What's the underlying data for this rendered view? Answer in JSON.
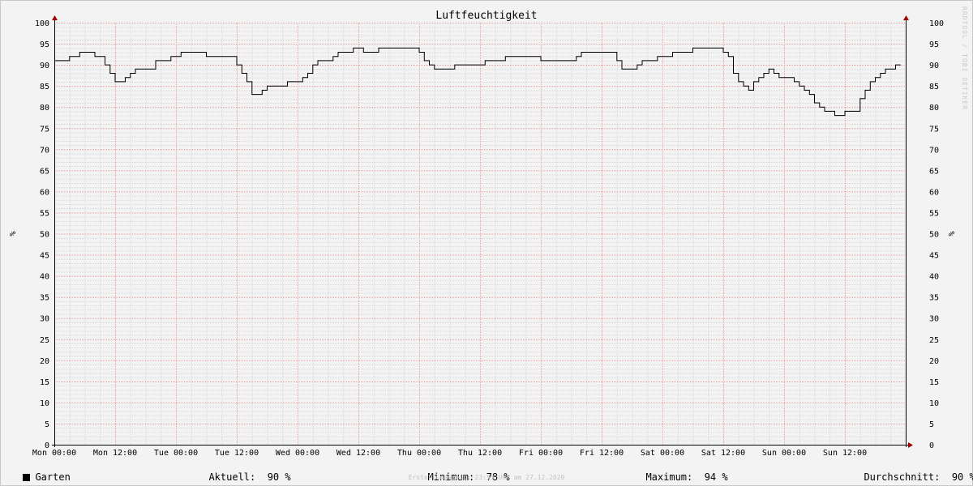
{
  "chart_data": {
    "type": "line",
    "title": "Luftfeuchtigkeit",
    "ylabel": "%",
    "ylim": [
      0,
      100
    ],
    "y_ticks": [
      0,
      5,
      10,
      15,
      20,
      25,
      30,
      35,
      40,
      45,
      50,
      55,
      60,
      65,
      70,
      75,
      80,
      85,
      90,
      95,
      100
    ],
    "x_ticks": [
      "Mon 00:00",
      "Mon 12:00",
      "Tue 00:00",
      "Tue 12:00",
      "Wed 00:00",
      "Wed 12:00",
      "Thu 00:00",
      "Thu 12:00",
      "Fri 00:00",
      "Fri 12:00",
      "Sat 00:00",
      "Sat 12:00",
      "Sun 00:00",
      "Sun 12:00"
    ],
    "x_unit": "hours since Mon 00:00",
    "xlim": [
      0,
      168
    ],
    "grid": true,
    "legend_position": "bottom-left",
    "series": [
      {
        "name": "Garten",
        "color": "#000000",
        "points": [
          [
            0,
            91
          ],
          [
            2,
            91
          ],
          [
            3,
            92
          ],
          [
            4,
            92
          ],
          [
            5,
            93
          ],
          [
            7,
            93
          ],
          [
            8,
            92
          ],
          [
            9,
            92
          ],
          [
            10,
            90
          ],
          [
            11,
            88
          ],
          [
            12,
            86
          ],
          [
            13,
            86
          ],
          [
            14,
            87
          ],
          [
            15,
            88
          ],
          [
            16,
            89
          ],
          [
            18,
            89
          ],
          [
            20,
            91
          ],
          [
            22,
            91
          ],
          [
            23,
            92
          ],
          [
            25,
            93
          ],
          [
            28,
            93
          ],
          [
            30,
            92
          ],
          [
            33,
            92
          ],
          [
            36,
            90
          ],
          [
            37,
            88
          ],
          [
            38,
            86
          ],
          [
            39,
            83
          ],
          [
            40,
            83
          ],
          [
            41,
            84
          ],
          [
            42,
            85
          ],
          [
            44,
            85
          ],
          [
            46,
            86
          ],
          [
            48,
            86
          ],
          [
            49,
            87
          ],
          [
            50,
            88
          ],
          [
            51,
            90
          ],
          [
            52,
            91
          ],
          [
            54,
            91
          ],
          [
            55,
            92
          ],
          [
            56,
            93
          ],
          [
            58,
            93
          ],
          [
            59,
            94
          ],
          [
            60,
            94
          ],
          [
            61,
            93
          ],
          [
            63,
            93
          ],
          [
            64,
            94
          ],
          [
            70,
            94
          ],
          [
            72,
            93
          ],
          [
            73,
            91
          ],
          [
            74,
            90
          ],
          [
            75,
            89
          ],
          [
            78,
            89
          ],
          [
            79,
            90
          ],
          [
            84,
            90
          ],
          [
            85,
            91
          ],
          [
            88,
            91
          ],
          [
            89,
            92
          ],
          [
            94,
            92
          ],
          [
            96,
            91
          ],
          [
            102,
            91
          ],
          [
            103,
            92
          ],
          [
            104,
            93
          ],
          [
            110,
            93
          ],
          [
            111,
            91
          ],
          [
            112,
            89
          ],
          [
            114,
            89
          ],
          [
            115,
            90
          ],
          [
            116,
            91
          ],
          [
            118,
            91
          ],
          [
            119,
            92
          ],
          [
            121,
            92
          ],
          [
            122,
            93
          ],
          [
            125,
            93
          ],
          [
            126,
            94
          ],
          [
            131,
            94
          ],
          [
            132,
            93
          ],
          [
            133,
            92
          ],
          [
            134,
            88
          ],
          [
            135,
            86
          ],
          [
            136,
            85
          ],
          [
            137,
            84
          ],
          [
            138,
            86
          ],
          [
            139,
            87
          ],
          [
            140,
            88
          ],
          [
            141,
            89
          ],
          [
            142,
            88
          ],
          [
            143,
            87
          ],
          [
            145,
            87
          ],
          [
            146,
            86
          ],
          [
            147,
            85
          ],
          [
            148,
            84
          ],
          [
            149,
            83
          ],
          [
            150,
            81
          ],
          [
            151,
            80
          ],
          [
            152,
            79
          ],
          [
            153,
            79
          ],
          [
            154,
            78
          ],
          [
            155,
            78
          ],
          [
            156,
            79
          ],
          [
            158,
            79
          ],
          [
            159,
            82
          ],
          [
            160,
            84
          ],
          [
            161,
            86
          ],
          [
            162,
            87
          ],
          [
            163,
            88
          ],
          [
            164,
            89
          ],
          [
            165,
            89
          ],
          [
            166,
            90
          ],
          [
            167,
            90
          ]
        ]
      }
    ],
    "stats": {
      "series_label": "Garten",
      "aktuell_label": "Aktuell:",
      "aktuell_value": "90 %",
      "minimum_label": "Minimum:",
      "minimum_value": "78 %",
      "maximum_label": "Maximum:",
      "maximum_value": "94 %",
      "durchschnitt_label": "Durchschnitt:",
      "durchschnitt_value": "90 %"
    }
  },
  "watermark": "RRDTOOL / TOBI OETIKER",
  "credit": "Erstellungszeit: 23:55 Uhr am 27.12.2020"
}
